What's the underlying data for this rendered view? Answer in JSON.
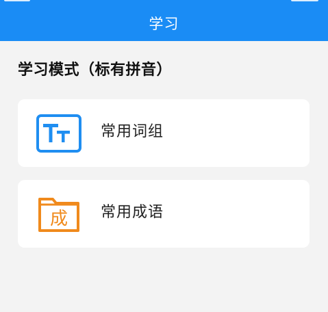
{
  "header": {
    "title": "学习"
  },
  "section": {
    "title": "学习模式（标有拼音）"
  },
  "items": [
    {
      "label": "常用词组",
      "icon": "text-size-icon",
      "icon_text": "Tт",
      "color": "#1f8ef1"
    },
    {
      "label": "常用成语",
      "icon": "idiom-card-icon",
      "icon_text": "成",
      "color": "#f08a1c"
    }
  ],
  "colors": {
    "header": "#1a8cf5",
    "background": "#f3f3f3"
  }
}
